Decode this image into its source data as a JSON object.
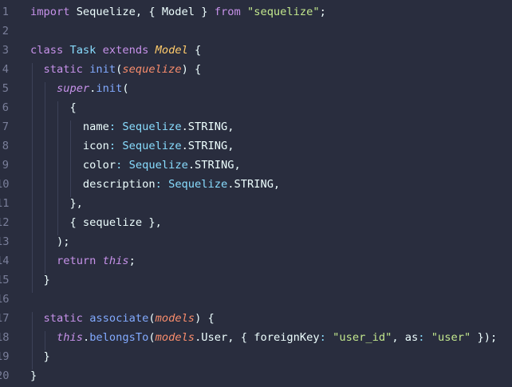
{
  "editor": {
    "lines": [
      {
        "n": "1",
        "tokens": [
          [
            "kw",
            "import"
          ],
          [
            "plain",
            " Sequelize, { Model } "
          ],
          [
            "kw",
            "from"
          ],
          [
            "plain",
            " "
          ],
          [
            "str",
            "\"sequelize\""
          ],
          [
            "plain",
            ";"
          ]
        ]
      },
      {
        "n": "2",
        "tokens": []
      },
      {
        "n": "3",
        "tokens": [
          [
            "kw",
            "class"
          ],
          [
            "plain",
            " "
          ],
          [
            "type",
            "Task"
          ],
          [
            "plain",
            " "
          ],
          [
            "kw",
            "extends"
          ],
          [
            "plain",
            " "
          ],
          [
            "model",
            "Model"
          ],
          [
            "plain",
            " {"
          ]
        ]
      },
      {
        "n": "4",
        "tokens": [
          [
            "plain",
            "  "
          ],
          [
            "kw",
            "static"
          ],
          [
            "plain",
            " "
          ],
          [
            "fn",
            "init"
          ],
          [
            "plain",
            "("
          ],
          [
            "param",
            "sequelize"
          ],
          [
            "plain",
            ") {"
          ]
        ]
      },
      {
        "n": "5",
        "tokens": [
          [
            "plain",
            "    "
          ],
          [
            "this",
            "super"
          ],
          [
            "plain",
            "."
          ],
          [
            "fn",
            "init"
          ],
          [
            "plain",
            "("
          ]
        ]
      },
      {
        "n": "6",
        "tokens": [
          [
            "plain",
            "      {"
          ]
        ]
      },
      {
        "n": "7",
        "tokens": [
          [
            "plain",
            "        name"
          ],
          [
            "punct",
            ":"
          ],
          [
            "plain",
            " "
          ],
          [
            "type",
            "Sequelize"
          ],
          [
            "plain",
            ".STRING,"
          ]
        ]
      },
      {
        "n": "8",
        "tokens": [
          [
            "plain",
            "        icon"
          ],
          [
            "punct",
            ":"
          ],
          [
            "plain",
            " "
          ],
          [
            "type",
            "Sequelize"
          ],
          [
            "plain",
            ".STRING,"
          ]
        ]
      },
      {
        "n": "9",
        "tokens": [
          [
            "plain",
            "        color"
          ],
          [
            "punct",
            ":"
          ],
          [
            "plain",
            " "
          ],
          [
            "type",
            "Sequelize"
          ],
          [
            "plain",
            ".STRING,"
          ]
        ]
      },
      {
        "n": "10",
        "tokens": [
          [
            "plain",
            "        description"
          ],
          [
            "punct",
            ":"
          ],
          [
            "plain",
            " "
          ],
          [
            "type",
            "Sequelize"
          ],
          [
            "plain",
            ".STRING,"
          ]
        ]
      },
      {
        "n": "11",
        "tokens": [
          [
            "plain",
            "      },"
          ]
        ]
      },
      {
        "n": "12",
        "tokens": [
          [
            "plain",
            "      { sequelize },"
          ]
        ]
      },
      {
        "n": "13",
        "tokens": [
          [
            "plain",
            "    );"
          ]
        ]
      },
      {
        "n": "14",
        "tokens": [
          [
            "plain",
            "    "
          ],
          [
            "kw",
            "return"
          ],
          [
            "plain",
            " "
          ],
          [
            "this",
            "this"
          ],
          [
            "plain",
            ";"
          ]
        ]
      },
      {
        "n": "15",
        "tokens": [
          [
            "plain",
            "  }"
          ]
        ]
      },
      {
        "n": "16",
        "tokens": []
      },
      {
        "n": "17",
        "tokens": [
          [
            "plain",
            "  "
          ],
          [
            "kw",
            "static"
          ],
          [
            "plain",
            " "
          ],
          [
            "fn",
            "associate"
          ],
          [
            "plain",
            "("
          ],
          [
            "param",
            "models"
          ],
          [
            "plain",
            ") {"
          ]
        ]
      },
      {
        "n": "18",
        "tokens": [
          [
            "plain",
            "    "
          ],
          [
            "this",
            "this"
          ],
          [
            "plain",
            "."
          ],
          [
            "fn",
            "belongsTo"
          ],
          [
            "plain",
            "("
          ],
          [
            "param",
            "models"
          ],
          [
            "plain",
            ".User, { foreignKey"
          ],
          [
            "punct",
            ":"
          ],
          [
            "plain",
            " "
          ],
          [
            "str",
            "\"user_id\""
          ],
          [
            "plain",
            ", as"
          ],
          [
            "punct",
            ":"
          ],
          [
            "plain",
            " "
          ],
          [
            "str",
            "\"user\""
          ],
          [
            "plain",
            " });"
          ]
        ]
      },
      {
        "n": "19",
        "tokens": [
          [
            "plain",
            "  }"
          ]
        ]
      },
      {
        "n": "20",
        "tokens": [
          [
            "plain",
            "}"
          ]
        ]
      }
    ]
  }
}
